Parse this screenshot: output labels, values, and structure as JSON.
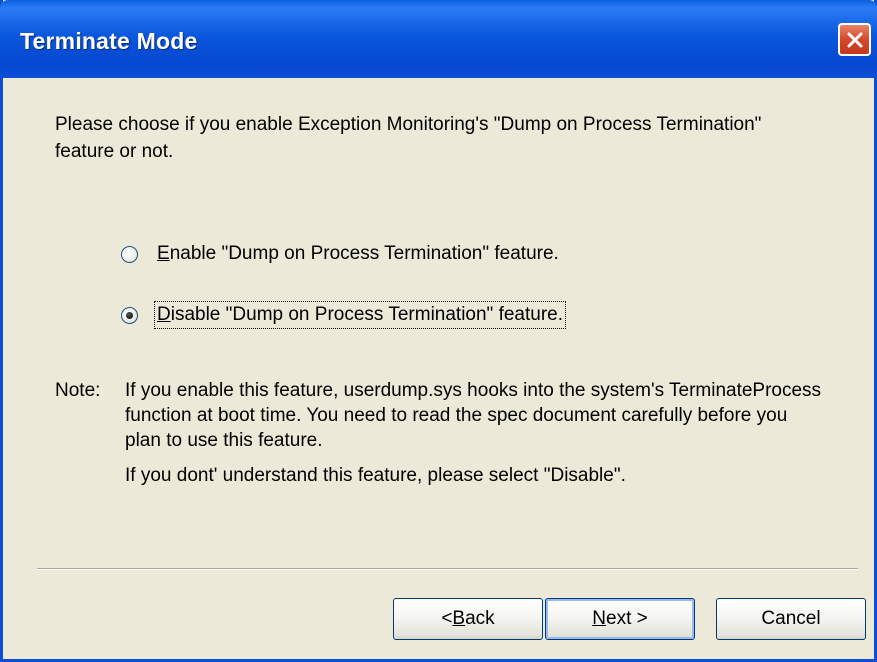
{
  "window": {
    "title": "Terminate Mode",
    "close_label": "Close"
  },
  "intro": {
    "text": "Please choose if you enable Exception Monitoring's \"Dump on Process Termination\" feature or not."
  },
  "options": [
    {
      "mnemonic": "E",
      "label_rest": "nable \"Dump on Process Termination\" feature.",
      "checked": false
    },
    {
      "mnemonic": "D",
      "label_rest": "isable \"Dump on Process Termination\" feature.",
      "checked": true
    }
  ],
  "note": {
    "label": "Note:",
    "paragraph1": "If you enable this feature, userdump.sys hooks into the system's TerminateProcess function at boot time. You need to read the spec document carefully before you plan to use this feature.",
    "paragraph2": "If you dont' understand this feature, please select \"Disable\"."
  },
  "buttons": {
    "back_prefix": "< ",
    "back_mnemonic": "B",
    "back_rest": "ack",
    "next_mnemonic": "N",
    "next_rest": "ext >",
    "cancel": "Cancel"
  },
  "colors": {
    "titlebar": "#0a4fd6",
    "dialog_bg": "#ece9d8",
    "close_button": "#d5482a"
  }
}
